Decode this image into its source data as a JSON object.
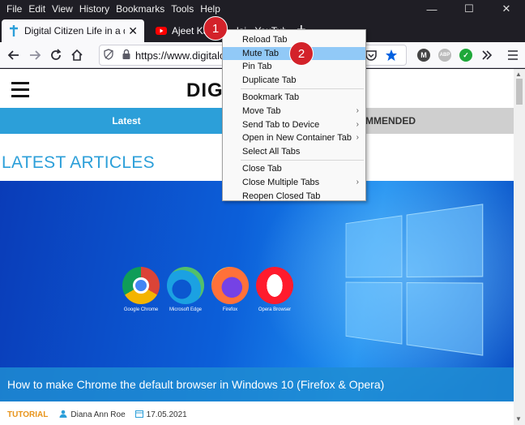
{
  "menubar": {
    "items": [
      "File",
      "Edit",
      "View",
      "History",
      "Bookmarks",
      "Tools",
      "Help"
    ]
  },
  "window_controls": {
    "minimize": "—",
    "maximize": "☐",
    "close": "✕"
  },
  "tabs": {
    "active": {
      "title": "Digital Citizen Life in a digital w",
      "close": "✕"
    },
    "second": {
      "title": "Ajeet Kau",
      "title_tail": "lai - YouTube"
    },
    "new_tab": "+"
  },
  "navbar": {
    "url": "https://www.digitalci",
    "pocket_icon": "pocket-icon",
    "star_icon": "star-icon"
  },
  "extensions": [
    {
      "label": "M",
      "color": "#444444"
    },
    {
      "label": "ABP",
      "color": "#bbbbbb"
    },
    {
      "label": "✓",
      "color": "#1fa83a"
    }
  ],
  "context_menu": {
    "items": [
      {
        "label": "Reload Tab",
        "submenu": false
      },
      {
        "label": "Mute Tab",
        "submenu": false,
        "highlighted": true
      },
      {
        "label": "Pin Tab",
        "submenu": false
      },
      {
        "label": "Duplicate Tab",
        "submenu": false
      },
      {
        "separator": true
      },
      {
        "label": "Bookmark Tab",
        "submenu": false
      },
      {
        "label": "Move Tab",
        "submenu": true
      },
      {
        "label": "Send Tab to Device",
        "submenu": true
      },
      {
        "label": "Open in New Container Tab",
        "submenu": true
      },
      {
        "label": "Select All Tabs",
        "submenu": false
      },
      {
        "separator": true
      },
      {
        "label": "Close Tab",
        "submenu": false
      },
      {
        "label": "Close Multiple Tabs",
        "submenu": true
      },
      {
        "label": "Reopen Closed Tab",
        "submenu": false
      }
    ]
  },
  "badges": [
    "1",
    "2"
  ],
  "site": {
    "logo": "DIG",
    "nav_latest": "Latest",
    "nav_recommended": "COMMENDED",
    "section_title": "LATEST ARTICLES",
    "hero_caption": "How to make Chrome the default browser in Windows 10 (Firefox & Opera)",
    "desktop_icons": [
      {
        "label": "Google Chrome"
      },
      {
        "label": "Microsoft Edge"
      },
      {
        "label": "Firefox"
      },
      {
        "label": "Opera Browser"
      }
    ],
    "meta": {
      "category": "TUTORIAL",
      "author": "Diana Ann Roe",
      "date": "17.05.2021"
    }
  }
}
